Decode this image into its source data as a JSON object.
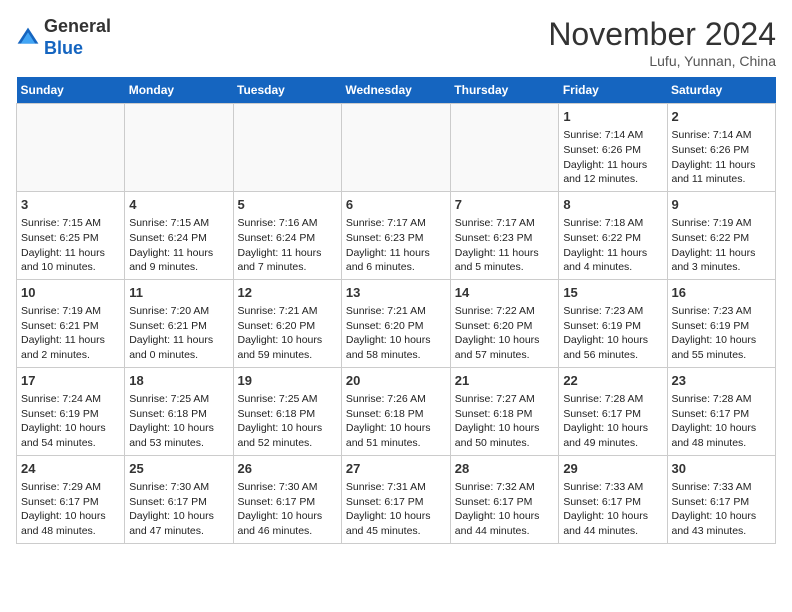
{
  "header": {
    "logo_general": "General",
    "logo_blue": "Blue",
    "month_title": "November 2024",
    "location": "Lufu, Yunnan, China"
  },
  "weekdays": [
    "Sunday",
    "Monday",
    "Tuesday",
    "Wednesday",
    "Thursday",
    "Friday",
    "Saturday"
  ],
  "weeks": [
    [
      {
        "day": "",
        "info": ""
      },
      {
        "day": "",
        "info": ""
      },
      {
        "day": "",
        "info": ""
      },
      {
        "day": "",
        "info": ""
      },
      {
        "day": "",
        "info": ""
      },
      {
        "day": "1",
        "info": "Sunrise: 7:14 AM\nSunset: 6:26 PM\nDaylight: 11 hours and 12 minutes."
      },
      {
        "day": "2",
        "info": "Sunrise: 7:14 AM\nSunset: 6:26 PM\nDaylight: 11 hours and 11 minutes."
      }
    ],
    [
      {
        "day": "3",
        "info": "Sunrise: 7:15 AM\nSunset: 6:25 PM\nDaylight: 11 hours and 10 minutes."
      },
      {
        "day": "4",
        "info": "Sunrise: 7:15 AM\nSunset: 6:24 PM\nDaylight: 11 hours and 9 minutes."
      },
      {
        "day": "5",
        "info": "Sunrise: 7:16 AM\nSunset: 6:24 PM\nDaylight: 11 hours and 7 minutes."
      },
      {
        "day": "6",
        "info": "Sunrise: 7:17 AM\nSunset: 6:23 PM\nDaylight: 11 hours and 6 minutes."
      },
      {
        "day": "7",
        "info": "Sunrise: 7:17 AM\nSunset: 6:23 PM\nDaylight: 11 hours and 5 minutes."
      },
      {
        "day": "8",
        "info": "Sunrise: 7:18 AM\nSunset: 6:22 PM\nDaylight: 11 hours and 4 minutes."
      },
      {
        "day": "9",
        "info": "Sunrise: 7:19 AM\nSunset: 6:22 PM\nDaylight: 11 hours and 3 minutes."
      }
    ],
    [
      {
        "day": "10",
        "info": "Sunrise: 7:19 AM\nSunset: 6:21 PM\nDaylight: 11 hours and 2 minutes."
      },
      {
        "day": "11",
        "info": "Sunrise: 7:20 AM\nSunset: 6:21 PM\nDaylight: 11 hours and 0 minutes."
      },
      {
        "day": "12",
        "info": "Sunrise: 7:21 AM\nSunset: 6:20 PM\nDaylight: 10 hours and 59 minutes."
      },
      {
        "day": "13",
        "info": "Sunrise: 7:21 AM\nSunset: 6:20 PM\nDaylight: 10 hours and 58 minutes."
      },
      {
        "day": "14",
        "info": "Sunrise: 7:22 AM\nSunset: 6:20 PM\nDaylight: 10 hours and 57 minutes."
      },
      {
        "day": "15",
        "info": "Sunrise: 7:23 AM\nSunset: 6:19 PM\nDaylight: 10 hours and 56 minutes."
      },
      {
        "day": "16",
        "info": "Sunrise: 7:23 AM\nSunset: 6:19 PM\nDaylight: 10 hours and 55 minutes."
      }
    ],
    [
      {
        "day": "17",
        "info": "Sunrise: 7:24 AM\nSunset: 6:19 PM\nDaylight: 10 hours and 54 minutes."
      },
      {
        "day": "18",
        "info": "Sunrise: 7:25 AM\nSunset: 6:18 PM\nDaylight: 10 hours and 53 minutes."
      },
      {
        "day": "19",
        "info": "Sunrise: 7:25 AM\nSunset: 6:18 PM\nDaylight: 10 hours and 52 minutes."
      },
      {
        "day": "20",
        "info": "Sunrise: 7:26 AM\nSunset: 6:18 PM\nDaylight: 10 hours and 51 minutes."
      },
      {
        "day": "21",
        "info": "Sunrise: 7:27 AM\nSunset: 6:18 PM\nDaylight: 10 hours and 50 minutes."
      },
      {
        "day": "22",
        "info": "Sunrise: 7:28 AM\nSunset: 6:17 PM\nDaylight: 10 hours and 49 minutes."
      },
      {
        "day": "23",
        "info": "Sunrise: 7:28 AM\nSunset: 6:17 PM\nDaylight: 10 hours and 48 minutes."
      }
    ],
    [
      {
        "day": "24",
        "info": "Sunrise: 7:29 AM\nSunset: 6:17 PM\nDaylight: 10 hours and 48 minutes."
      },
      {
        "day": "25",
        "info": "Sunrise: 7:30 AM\nSunset: 6:17 PM\nDaylight: 10 hours and 47 minutes."
      },
      {
        "day": "26",
        "info": "Sunrise: 7:30 AM\nSunset: 6:17 PM\nDaylight: 10 hours and 46 minutes."
      },
      {
        "day": "27",
        "info": "Sunrise: 7:31 AM\nSunset: 6:17 PM\nDaylight: 10 hours and 45 minutes."
      },
      {
        "day": "28",
        "info": "Sunrise: 7:32 AM\nSunset: 6:17 PM\nDaylight: 10 hours and 44 minutes."
      },
      {
        "day": "29",
        "info": "Sunrise: 7:33 AM\nSunset: 6:17 PM\nDaylight: 10 hours and 44 minutes."
      },
      {
        "day": "30",
        "info": "Sunrise: 7:33 AM\nSunset: 6:17 PM\nDaylight: 10 hours and 43 minutes."
      }
    ]
  ]
}
